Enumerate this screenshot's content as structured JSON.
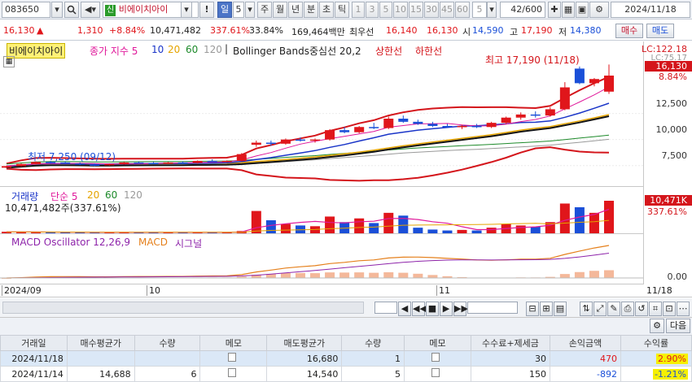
{
  "toolbar": {
    "code": "083650",
    "badge": "신",
    "stock_name": "비에이치아이",
    "period_value": "5",
    "periods": [
      "일",
      "주",
      "월",
      "년",
      "분",
      "초",
      "틱"
    ],
    "nums": [
      "1",
      "3",
      "5",
      "10",
      "15",
      "30",
      "45",
      "60",
      "5"
    ],
    "count": "42/600",
    "date": "2024/11/18"
  },
  "info": {
    "price": "16,130",
    "arrow": "▲",
    "change": "1,310",
    "change_pct": "+8.84%",
    "volume": "10,471,482",
    "vol_ratio": "337.61%",
    "turnover": "33.84%",
    "amount": "169,464백만",
    "best_label": "최우선",
    "best_sell": "16,140",
    "best_buy": "16,130",
    "open_label": "시",
    "open": "14,590",
    "high_label": "고",
    "high": "17,190",
    "low_label": "저",
    "low": "14,380",
    "buy_btn": "매수",
    "sell_btn": "매도"
  },
  "price_pane": {
    "name_tag": "비에이치아이",
    "ma_label": "종가 지수 5",
    "ma_periods": [
      "10",
      "20",
      "60",
      "120"
    ],
    "bb_label": "Bollinger Bands중심선 20,2",
    "bb_upper": "상한선",
    "bb_lower": "하한선",
    "high_annot": "최고 17,190 (11/18)",
    "low_annot": "최저 7,250 (09/12)",
    "lc_label": "LC:122.18",
    "lc_sub": "LC:75.17",
    "last_price_tag": "16,130",
    "last_pct": "8.84%",
    "ticks": [
      "12,500",
      "10,000",
      "7,500"
    ]
  },
  "volume_pane": {
    "label": "거래량",
    "ma_label": "단순 5",
    "ma_periods": [
      "20",
      "60",
      "120"
    ],
    "value": "10,471,482주(337.61%)",
    "tag": "10,471K",
    "tag_pct": "337.61%"
  },
  "macd_pane": {
    "label": "MACD Oscillator 12,26,9",
    "macd": "MACD",
    "signal": "시그널",
    "zero": "0.00"
  },
  "xaxis": {
    "labels": [
      "2024/09",
      "10",
      "11"
    ],
    "right_label": "11/18"
  },
  "table": {
    "headers": [
      "거래일",
      "매수평균가",
      "수량",
      "메모",
      "매도평균가",
      "수량",
      "메모",
      "수수료+제세금",
      "손익금액",
      "수익률"
    ],
    "rows": [
      [
        "2024/11/18",
        "",
        "",
        "",
        "16,680",
        "1",
        "",
        "30",
        "470",
        "2.90%"
      ],
      [
        "2024/11/14",
        "14,688",
        "6",
        "",
        "14,540",
        "5",
        "",
        "150",
        "-892",
        "-1.21%"
      ]
    ],
    "more_btn": "다음"
  },
  "chart_data": {
    "type": "candlestick",
    "x_labels": [
      "2024/09",
      "10",
      "11"
    ],
    "ylim": [
      6000,
      18000
    ],
    "candles": [
      {
        "o": 7300,
        "h": 7500,
        "l": 7250,
        "c": 7450
      },
      {
        "o": 7450,
        "h": 7700,
        "l": 7400,
        "c": 7650
      },
      {
        "o": 7650,
        "h": 7900,
        "l": 7600,
        "c": 7850
      },
      {
        "o": 7850,
        "h": 7950,
        "l": 7700,
        "c": 7800
      },
      {
        "o": 7800,
        "h": 7900,
        "l": 7650,
        "c": 7700
      },
      {
        "o": 7700,
        "h": 7800,
        "l": 7550,
        "c": 7600
      },
      {
        "o": 7600,
        "h": 7700,
        "l": 7450,
        "c": 7550
      },
      {
        "o": 7550,
        "h": 7700,
        "l": 7500,
        "c": 7650
      },
      {
        "o": 7650,
        "h": 7850,
        "l": 7600,
        "c": 7800
      },
      {
        "o": 7800,
        "h": 7900,
        "l": 7700,
        "c": 7750
      },
      {
        "o": 7750,
        "h": 7850,
        "l": 7650,
        "c": 7700
      },
      {
        "o": 7700,
        "h": 7850,
        "l": 7650,
        "c": 7800
      },
      {
        "o": 7800,
        "h": 7900,
        "l": 7700,
        "c": 7750
      },
      {
        "o": 7750,
        "h": 8000,
        "l": 7700,
        "c": 7950
      },
      {
        "o": 7950,
        "h": 8100,
        "l": 7850,
        "c": 7900
      },
      {
        "o": 7900,
        "h": 8000,
        "l": 7800,
        "c": 7950
      },
      {
        "o": 7950,
        "h": 8700,
        "l": 7900,
        "c": 8600
      },
      {
        "o": 9500,
        "h": 9900,
        "l": 9300,
        "c": 9700
      },
      {
        "o": 9700,
        "h": 9900,
        "l": 9400,
        "c": 9600
      },
      {
        "o": 9600,
        "h": 10100,
        "l": 9500,
        "c": 10000
      },
      {
        "o": 10000,
        "h": 10200,
        "l": 9800,
        "c": 9900
      },
      {
        "o": 9900,
        "h": 10100,
        "l": 9700,
        "c": 10000
      },
      {
        "o": 10000,
        "h": 11000,
        "l": 9900,
        "c": 10900
      },
      {
        "o": 10900,
        "h": 11200,
        "l": 10600,
        "c": 10700
      },
      {
        "o": 10700,
        "h": 11300,
        "l": 10600,
        "c": 11200
      },
      {
        "o": 11200,
        "h": 11600,
        "l": 11000,
        "c": 11100
      },
      {
        "o": 11100,
        "h": 12200,
        "l": 11000,
        "c": 12000
      },
      {
        "o": 12000,
        "h": 12300,
        "l": 11600,
        "c": 11700
      },
      {
        "o": 11700,
        "h": 11900,
        "l": 11400,
        "c": 11500
      },
      {
        "o": 11500,
        "h": 11700,
        "l": 11200,
        "c": 11300
      },
      {
        "o": 11300,
        "h": 11500,
        "l": 11100,
        "c": 11200
      },
      {
        "o": 11200,
        "h": 11400,
        "l": 11000,
        "c": 11300
      },
      {
        "o": 11300,
        "h": 11500,
        "l": 11100,
        "c": 11200
      },
      {
        "o": 11200,
        "h": 11700,
        "l": 11100,
        "c": 11600
      },
      {
        "o": 11600,
        "h": 12200,
        "l": 11500,
        "c": 12100
      },
      {
        "o": 12100,
        "h": 12600,
        "l": 11900,
        "c": 12400
      },
      {
        "o": 12400,
        "h": 12700,
        "l": 12100,
        "c": 12300
      },
      {
        "o": 12300,
        "h": 13100,
        "l": 12200,
        "c": 12900
      },
      {
        "o": 12900,
        "h": 15500,
        "l": 12800,
        "c": 15000
      },
      {
        "o": 16800,
        "h": 17000,
        "l": 15300,
        "c": 15400
      },
      {
        "o": 15400,
        "h": 15900,
        "l": 15100,
        "c": 15800
      },
      {
        "o": 14590,
        "h": 17190,
        "l": 14380,
        "c": 16130
      }
    ],
    "volume": [
      80,
      70,
      60,
      55,
      50,
      45,
      40,
      50,
      60,
      55,
      45,
      50,
      40,
      60,
      55,
      50,
      120,
      1200,
      700,
      500,
      420,
      380,
      900,
      600,
      800,
      550,
      1100,
      950,
      300,
      200,
      150,
      180,
      150,
      300,
      500,
      420,
      350,
      600,
      1600,
      1400,
      1100,
      1750
    ]
  }
}
